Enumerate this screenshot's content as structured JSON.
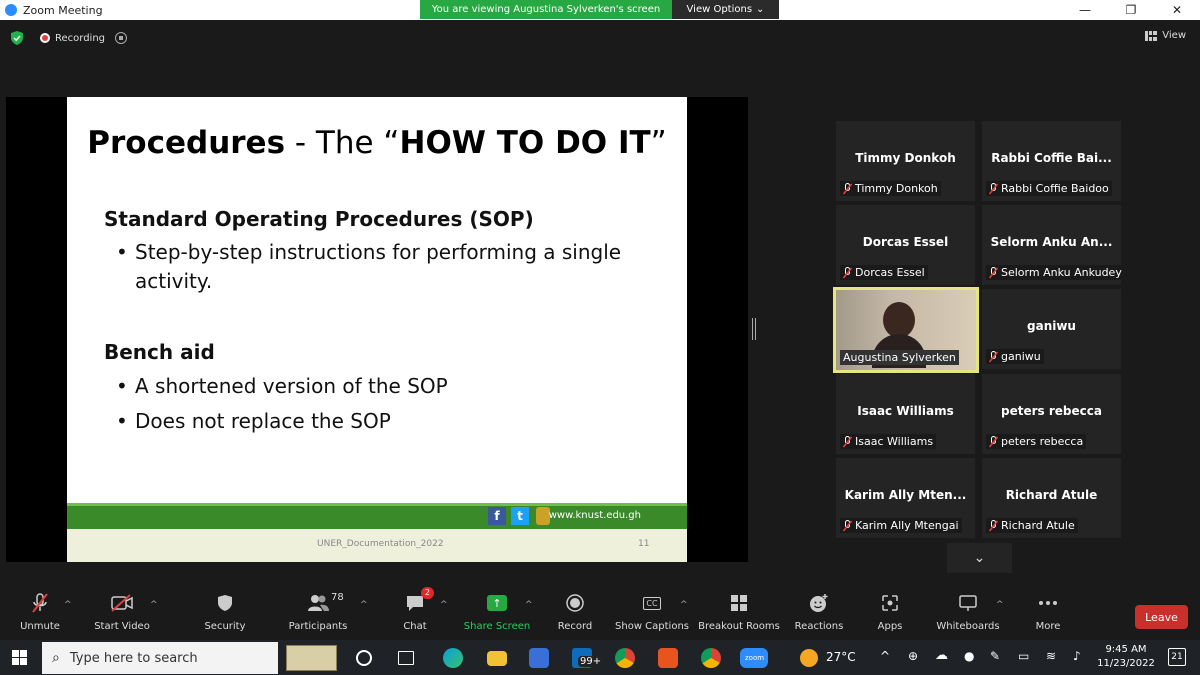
{
  "window": {
    "title": "Zoom Meeting",
    "viewing_banner": "You are viewing Augustina Sylverken's screen",
    "view_options": "View Options",
    "minimize": "—",
    "restore": "❐",
    "close": "✕"
  },
  "statusbar": {
    "recording_label": "Recording",
    "view_label": "View"
  },
  "slide": {
    "title_bold_1": "Procedures",
    "title_regular": " - The “",
    "title_bold_2": "HOW TO DO IT",
    "title_end": "”",
    "sop_heading": "Standard Operating Procedures (SOP)",
    "sop_bullet": "Step-by-step instructions for performing a single activity.",
    "bench_heading": "Bench aid",
    "bench_bullets": [
      "A shortened version of the SOP",
      "Does not replace the SOP"
    ],
    "site_url": "www.knust.edu.gh",
    "footer_doc": "UNER_Documentation_2022",
    "slide_number": "11",
    "fb_glyph": "f",
    "tw_glyph": "t"
  },
  "participants": [
    {
      "display": "Timmy Donkoh",
      "label": "Timmy Donkoh"
    },
    {
      "display": "Rabbi Coffie Bai...",
      "label": "Rabbi Coffie Baidoo"
    },
    {
      "display": "Dorcas Essel",
      "label": "Dorcas Essel"
    },
    {
      "display": "Selorm Anku An...",
      "label": "Selorm Anku Ankudey"
    },
    {
      "display": "",
      "label": "Augustina Sylverken"
    },
    {
      "display": "ganiwu",
      "label": "ganiwu"
    },
    {
      "display": "Isaac Williams",
      "label": "Isaac Williams"
    },
    {
      "display": "peters rebecca",
      "label": "peters rebecca"
    },
    {
      "display": "Karim Ally Mten...",
      "label": "Karim Ally Mtengai"
    },
    {
      "display": "Richard Atule",
      "label": "Richard Atule"
    }
  ],
  "toolbar": {
    "unmute": "Unmute",
    "start_video": "Start Video",
    "security": "Security",
    "participants": "Participants",
    "participant_count": "78",
    "chat": "Chat",
    "chat_badge": "2",
    "share_screen": "Share Screen",
    "record": "Record",
    "show_captions": "Show Captions",
    "captions_glyph": "CC",
    "breakout_rooms": "Breakout Rooms",
    "reactions": "Reactions",
    "apps": "Apps",
    "whiteboards": "Whiteboards",
    "more": "More",
    "leave": "Leave"
  },
  "taskbar": {
    "search_placeholder": "Type here to search",
    "mail_badge": "99+",
    "zoom_label": "zoom",
    "weather": "27°C",
    "time": "9:45 AM",
    "date": "11/23/2022",
    "notifications": "21"
  },
  "colors": {
    "share_banner": "#27a843",
    "leave": "#c9302c",
    "active_speaker_border": "#e6e680"
  }
}
